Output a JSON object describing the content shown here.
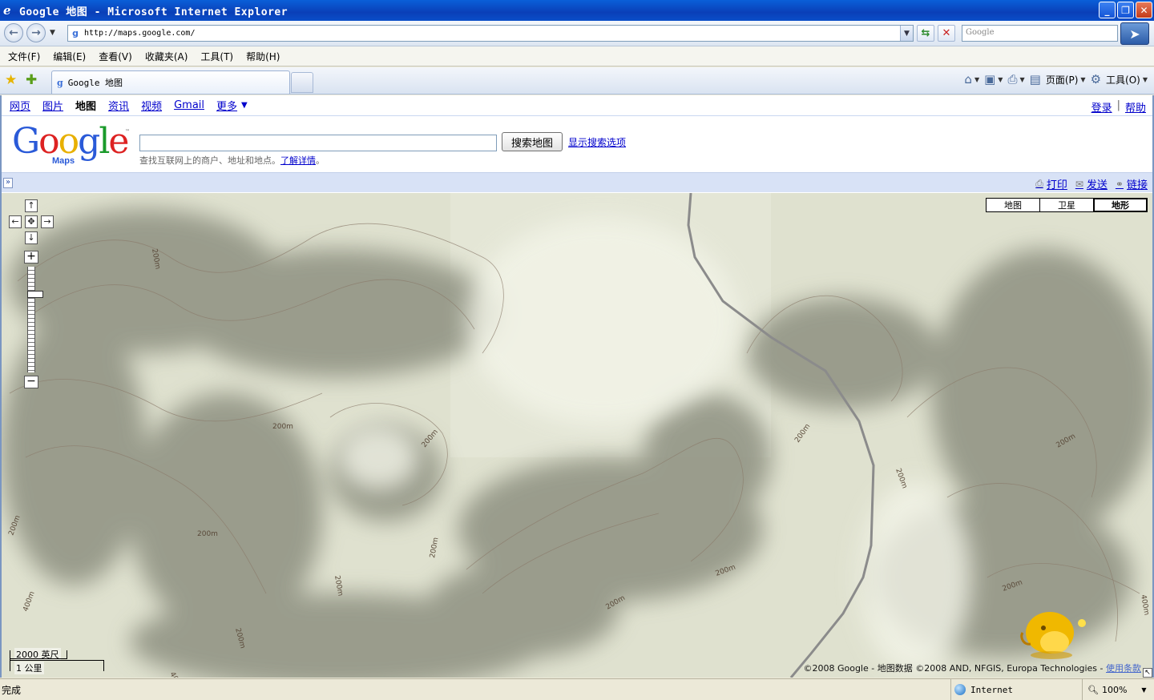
{
  "window": {
    "title": "Google 地图 - Microsoft Internet Explorer"
  },
  "address_bar": {
    "url": "http://maps.google.com/",
    "search_placeholder": "Google"
  },
  "menu": [
    "文件(F)",
    "编辑(E)",
    "查看(V)",
    "收藏夹(A)",
    "工具(T)",
    "帮助(H)"
  ],
  "tab": {
    "label": "Google 地图"
  },
  "command_bar": {
    "page_label": "页面(P)",
    "tools_label": "工具(O)"
  },
  "top_nav": {
    "links": [
      "网页",
      "图片",
      "地图",
      "资讯",
      "视频",
      "Gmail",
      "更多"
    ],
    "current": "地图",
    "signin": "登录",
    "help": "帮助"
  },
  "logo": {
    "wordmark": "Google",
    "product": "Maps",
    "tm": "™"
  },
  "search": {
    "query": "",
    "button": "搜索地图",
    "options_link": "显示搜索选项",
    "hint_text": "查找互联网上的商户、地址和地点。",
    "hint_link": "了解详情",
    "hint_end": "。"
  },
  "panel_tools": {
    "print": "打印",
    "send": "发送",
    "link": "链接"
  },
  "map_types": [
    "地图",
    "卫星",
    "地形"
  ],
  "map_type_selected": "地形",
  "contour_labels": [
    "200m",
    "200m",
    "200m",
    "200m",
    "200m",
    "200m",
    "200m",
    "200m",
    "200m",
    "200m",
    "200m",
    "200m",
    "200m",
    "200m",
    "200m",
    "400m",
    "400m",
    "400m"
  ],
  "scale": {
    "imperial": "2000 英尺",
    "metric": "1 公里"
  },
  "copyright": {
    "text": "©2008 Google - 地图数据 ©2008 AND, NFGIS, Europa Technologies - ",
    "terms": "使用条款"
  },
  "status": {
    "text": "完成",
    "zone": "Internet",
    "zoom": "100%"
  },
  "colors": {
    "link": "#0000cc",
    "titlebar": "#0a4ec8",
    "terrain": "#dcdfcc"
  }
}
